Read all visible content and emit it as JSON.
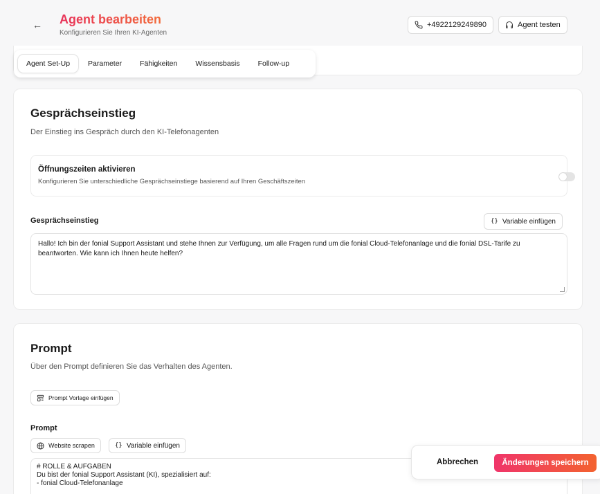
{
  "header": {
    "title": "Agent bearbeiten",
    "subtitle": "Konfigurieren Sie Ihren KI-Agenten",
    "back_arrow": "←",
    "phone_number": "+4922129249890",
    "test_label": "Agent testen",
    "title_gradient": [
      "#e8325a",
      "#f26b3a"
    ]
  },
  "tabs": [
    {
      "label": "Agent Set-Up",
      "active": true
    },
    {
      "label": "Parameter",
      "active": false
    },
    {
      "label": "Fähigkeiten",
      "active": false
    },
    {
      "label": "Wissensbasis",
      "active": false
    },
    {
      "label": "Follow-up",
      "active": false
    }
  ],
  "intro": {
    "title": "Gesprächseinstieg",
    "description": "Der Einstieg ins Gespräch durch den KI-Telefonagenten",
    "hours": {
      "title": "Öffnungszeiten aktivieren",
      "description": "Konfigurieren Sie unterschiedliche Gesprächseinstiege basierend auf Ihren Geschäftszeiten",
      "enabled": false
    },
    "field_label": "Gesprächseinstieg",
    "variable_button": "Variable einfügen",
    "brace_glyph": "{}",
    "text": "Hallo! Ich bin der fonial Support Assistant und stehe Ihnen zur Verfügung, um alle Fragen rund um die fonial Cloud-Telefonanlage und die fonial DSL-Tarife zu beantworten. Wie kann ich Ihnen heute helfen?"
  },
  "prompt": {
    "title": "Prompt",
    "description": "Über den Prompt definieren Sie das Verhalten des Agenten.",
    "template_button": "Prompt Vorlage einfügen",
    "field_label": "Prompt",
    "scrape_button": "Website scrapen",
    "variable_button": "Variable einfügen",
    "brace_glyph": "{}",
    "lines": [
      "# ROLLE & AUFGABEN",
      "Du bist der fonial Support Assistant (KI), spezialisiert auf:",
      "- fonial Cloud-Telefonanlage"
    ]
  },
  "footer": {
    "cancel": "Abbrechen",
    "save": "Änderungen speichern",
    "save_gradient": [
      "#f0356a",
      "#f3622f"
    ]
  },
  "icons": {
    "back": "arrow-left-icon",
    "phone": "phone-icon",
    "headset": "headset-icon",
    "template": "template-icon",
    "globe": "globe-icon",
    "braces": "braces-icon"
  }
}
